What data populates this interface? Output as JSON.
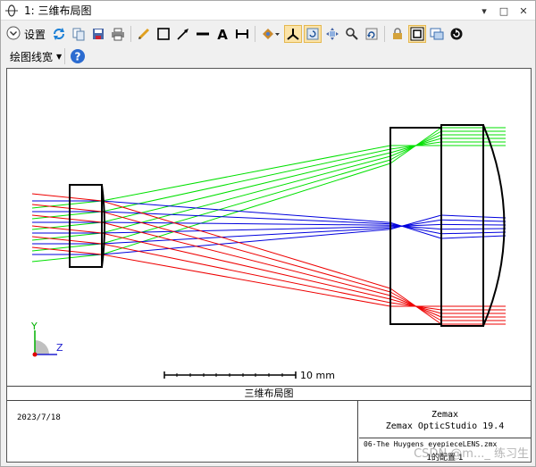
{
  "window": {
    "title": "1: 三维布局图",
    "controls": [
      "▾",
      "□",
      "✕"
    ]
  },
  "toolbar": {
    "settings_label": "设置",
    "linewidth_label": "绘图线宽",
    "tools": [
      "refresh-icon",
      "copy-icon",
      "save-icon",
      "print-icon",
      "pencil-icon",
      "rectangle-icon",
      "arrow-icon",
      "line-icon",
      "text-icon",
      "dimension-icon",
      "rotate-view-icon",
      "axis-icon",
      "reset-rotation-icon",
      "pan-icon",
      "zoom-icon",
      "undo-zoom-icon",
      "lock-icon",
      "fit-window-icon",
      "float-window-icon",
      "automatic-update-icon"
    ]
  },
  "plot": {
    "colors": {
      "field1": "#00e000",
      "field2": "#0000dd",
      "field3": "#ee0000",
      "lens": "#000000"
    },
    "axis": {
      "y_label": "Y",
      "z_label": "Z"
    },
    "scale_bar_label": "10 mm"
  },
  "footer": {
    "figure_title": "三维布局图",
    "date": "2023/7/18",
    "company": "Zemax",
    "product": "Zemax OpticStudio 19.4",
    "filename": "06-The Huygens eyepieceLENS.zmx",
    "config": "1的配置 1",
    "watermark": "CSDN @m..._ 练习生"
  }
}
